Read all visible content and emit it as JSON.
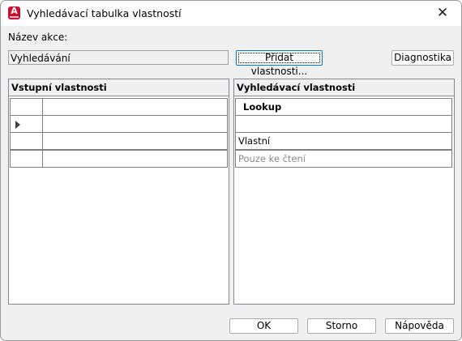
{
  "window": {
    "title": "Vyhledávací tabulka vlastností",
    "close_glyph": "✕",
    "app_icon_letter": "A"
  },
  "action": {
    "label": "Název akce:",
    "value": "Vyhledávání"
  },
  "buttons": {
    "add_properties": "Přidat vlastnosti...",
    "diagnostics": "Diagnostika",
    "ok": "OK",
    "cancel": "Storno",
    "help": "Nápověda"
  },
  "input_panel": {
    "header": "Vstupní vlastnosti",
    "rows": [
      "",
      "",
      "",
      ""
    ],
    "current_row": 1
  },
  "lookup_panel": {
    "header": "Vyhledávací vlastnosti",
    "column": "Lookup",
    "rows": [
      "",
      "Vlastní",
      "Pouze ke čtení"
    ]
  },
  "icons": [
    "app-icon",
    "close-icon",
    "row-pointer-icon"
  ],
  "colors": {
    "app_icon": "#c8102e",
    "focus_border": "#0078d4",
    "dialog_bg": "#f0f0f0"
  }
}
